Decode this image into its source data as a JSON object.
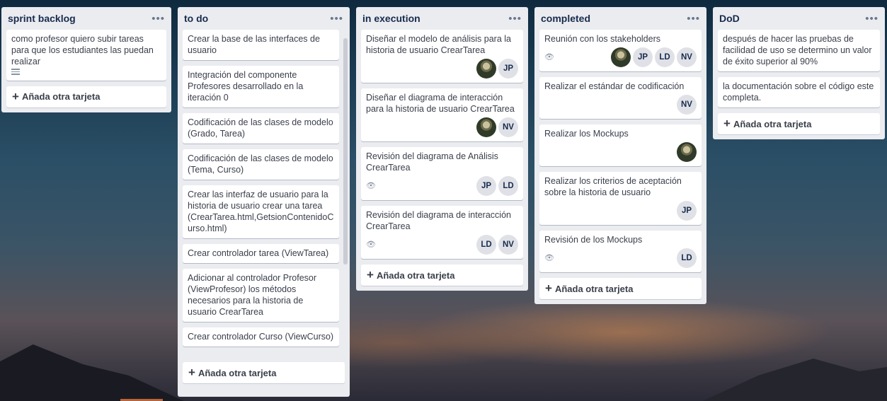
{
  "board": {
    "lists": [
      {
        "title": "sprint backlog",
        "cards": [
          {
            "text": "como profesor quiero subir tareas para que los estudiantes las puedan realizar",
            "has_description": true
          }
        ],
        "add_label": "Añada otra tarjeta"
      },
      {
        "title": "to do",
        "cards": [
          {
            "text": "Crear la base de las interfaces de usuario"
          },
          {
            "text": "Integración del componente Profesores desarrollado en la iteración 0"
          },
          {
            "text": "Codificación de las clases de modelo (Grado, Tarea)"
          },
          {
            "text": "Codificación de las clases de modelo (Tema, Curso)"
          },
          {
            "text": "Crear las interfaz de usuario para la historia de usuario crear una tarea (CrearTarea.html,GetsionContenidoCurso.html)"
          },
          {
            "text": "Crear controlador tarea (ViewTarea)"
          },
          {
            "text": "Adicionar al controlador Profesor (ViewProfesor) los métodos necesarios para la historia de usuario CrearTarea"
          },
          {
            "text": "Crear controlador Curso (ViewCurso)"
          }
        ],
        "add_label": "Añada otra tarjeta"
      },
      {
        "title": "in execution",
        "cards": [
          {
            "text": "Diseñar el modelo de análisis para la historia de usuario CrearTarea",
            "members": [
              "photo",
              "JP"
            ]
          },
          {
            "text": "Diseñar el diagrama de interacción para la historia de usuario CrearTarea",
            "members": [
              "photo",
              "NV"
            ]
          },
          {
            "text": "Revisión del diagrama de Análisis CrearTarea",
            "watch": true,
            "members": [
              "JP",
              "LD"
            ]
          },
          {
            "text": "Revisión del diagrama de interacción CrearTarea",
            "watch": true,
            "members": [
              "LD",
              "NV"
            ]
          }
        ],
        "add_label": "Añada otra tarjeta"
      },
      {
        "title": "completed",
        "cards": [
          {
            "text": "Reunión con los stakeholders",
            "watch": true,
            "members": [
              "photo",
              "JP",
              "LD",
              "NV"
            ]
          },
          {
            "text": "Realizar el estándar de codificación",
            "members": [
              "NV"
            ]
          },
          {
            "text": "Realizar los Mockups",
            "members": [
              "photo"
            ]
          },
          {
            "text": "Realizar los criterios de aceptación sobre la historia de usuario",
            "members": [
              "JP"
            ]
          },
          {
            "text": "Revisión de los Mockups",
            "watch": true,
            "members": [
              "LD"
            ]
          }
        ],
        "add_label": "Añada otra tarjeta"
      },
      {
        "title": "DoD",
        "cards": [
          {
            "text": "después de hacer las pruebas de facilidad de uso se determino un valor de éxito superior al 90%"
          },
          {
            "text": "la documentación sobre el código este completa."
          }
        ],
        "add_label": "Añada otra tarjeta"
      }
    ],
    "menu_glyph": "•••",
    "plus_glyph": "+",
    "watch_glyph": "👁"
  }
}
